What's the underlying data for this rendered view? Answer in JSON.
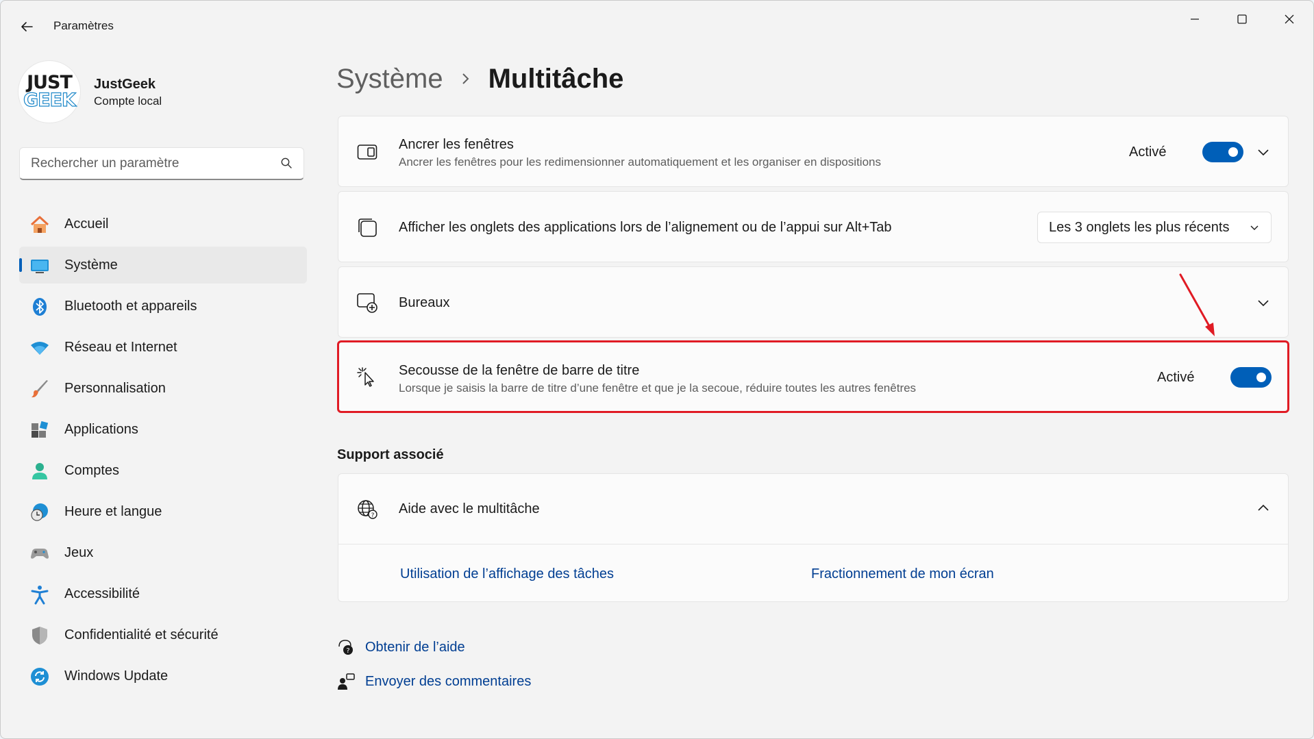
{
  "window": {
    "title": "Paramètres",
    "accent_color": "#005fb8",
    "highlight_color": "#e01b24"
  },
  "profile": {
    "logo_line1": "JUST",
    "logo_line2": "GEEK",
    "name": "JustGeek",
    "account_type": "Compte local"
  },
  "search": {
    "placeholder": "Rechercher un paramètre"
  },
  "sidebar": {
    "items": [
      {
        "label": "Accueil",
        "icon": "home-icon"
      },
      {
        "label": "Système",
        "icon": "system-icon",
        "selected": true
      },
      {
        "label": "Bluetooth et appareils",
        "icon": "bluetooth-icon"
      },
      {
        "label": "Réseau et Internet",
        "icon": "wifi-icon"
      },
      {
        "label": "Personnalisation",
        "icon": "brush-icon"
      },
      {
        "label": "Applications",
        "icon": "apps-icon"
      },
      {
        "label": "Comptes",
        "icon": "account-icon"
      },
      {
        "label": "Heure et langue",
        "icon": "clock-globe-icon"
      },
      {
        "label": "Jeux",
        "icon": "gamepad-icon"
      },
      {
        "label": "Accessibilité",
        "icon": "accessibility-icon"
      },
      {
        "label": "Confidentialité et sécurité",
        "icon": "shield-icon"
      },
      {
        "label": "Windows Update",
        "icon": "update-icon"
      }
    ]
  },
  "breadcrumb": {
    "parent": "Système",
    "current": "Multitâche"
  },
  "settings": {
    "snap": {
      "title": "Ancrer les fenêtres",
      "subtitle": "Ancrer les fenêtres pour les redimensionner automatiquement et les organiser en dispositions",
      "status": "Activé",
      "enabled": true
    },
    "alt_tab": {
      "title": "Afficher les onglets des applications lors de l’alignement ou de l’appui sur Alt+Tab",
      "selected_option": "Les 3 onglets les plus récents"
    },
    "desktops": {
      "title": "Bureaux"
    },
    "shake": {
      "title": "Secousse de la fenêtre de barre de titre",
      "subtitle": "Lorsque je saisis la barre de titre d’une fenêtre et que je la secoue, réduire toutes les autres fenêtres",
      "status": "Activé",
      "enabled": true
    }
  },
  "support": {
    "section_title": "Support associé",
    "help_title": "Aide avec le multitâche",
    "links": [
      "Utilisation de l’affichage des tâches",
      "Fractionnement de mon écran"
    ]
  },
  "footer": {
    "get_help": "Obtenir de l’aide",
    "feedback": "Envoyer des commentaires"
  }
}
